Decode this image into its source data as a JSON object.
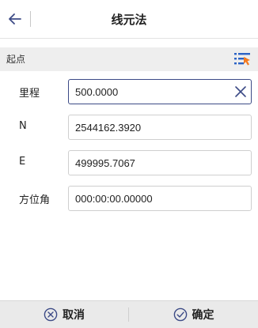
{
  "header": {
    "title": "线元法",
    "back_icon": "arrow-left-icon"
  },
  "section": {
    "title": "起点",
    "action_icon": "list-select-icon"
  },
  "fields": [
    {
      "label": "里程",
      "value": "500.0000"
    },
    {
      "label": "N",
      "value": "2544162.3920"
    },
    {
      "label": "E",
      "value": "499995.7067"
    },
    {
      "label": "方位角",
      "value": "000:00:00.00000"
    }
  ],
  "footer": {
    "cancel_label": "取消",
    "cancel_icon": "circle-x-icon",
    "confirm_label": "确定",
    "confirm_icon": "circle-check-icon"
  },
  "colors": {
    "accent": "#3c4a86",
    "icon_orange": "#f47a20",
    "icon_blue": "#2b63c5"
  }
}
